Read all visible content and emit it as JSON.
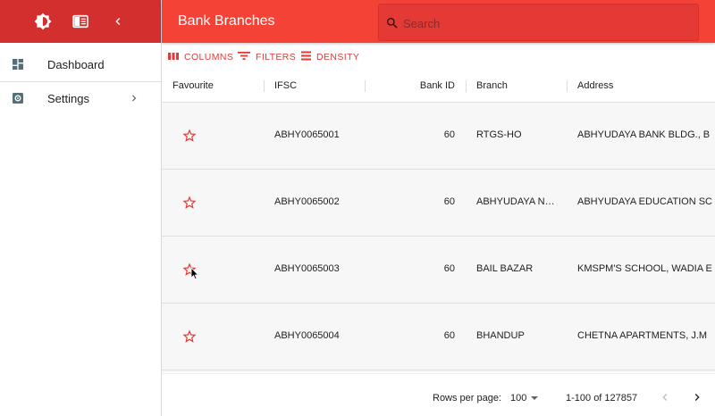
{
  "sidebar": {
    "items": [
      {
        "label": "Dashboard",
        "icon": "dashboard-icon"
      },
      {
        "label": "Settings",
        "icon": "settings-icon"
      }
    ]
  },
  "header": {
    "title": "Bank Branches",
    "search_placeholder": "Search"
  },
  "toolbar": {
    "columns_label": "COLUMNS",
    "filters_label": "FILTERS",
    "density_label": "DENSITY"
  },
  "grid": {
    "columns": {
      "favourite": "Favourite",
      "ifsc": "IFSC",
      "bank_id": "Bank ID",
      "branch": "Branch",
      "address": "Address"
    },
    "rows": [
      {
        "ifsc": "ABHY0065001",
        "bank_id": "60",
        "branch": "RTGS-HO",
        "address": "ABHYUDAYA BANK BLDG., B"
      },
      {
        "ifsc": "ABHY0065002",
        "bank_id": "60",
        "branch": "ABHYUDAYA N…",
        "address": "ABHYUDAYA EDUCATION SC"
      },
      {
        "ifsc": "ABHY0065003",
        "bank_id": "60",
        "branch": "BAIL BAZAR",
        "address": "KMSPM'S SCHOOL, WADIA E"
      },
      {
        "ifsc": "ABHY0065004",
        "bank_id": "60",
        "branch": "BHANDUP",
        "address": "CHETNA APARTMENTS, J.M"
      }
    ]
  },
  "footer": {
    "rows_per_page_label": "Rows per page:",
    "rows_per_page_value": "100",
    "pagination_text": "1-100 of 127857"
  },
  "colors": {
    "sidebar_header": "#d32f2f",
    "app_bar": "#f44336",
    "accent": "#e53935"
  }
}
